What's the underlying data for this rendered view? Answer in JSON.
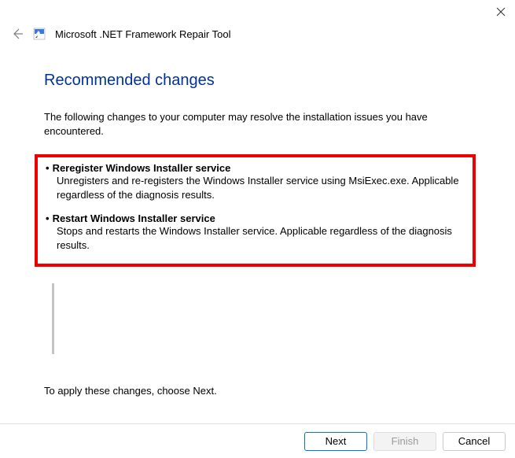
{
  "window": {
    "app_title": "Microsoft .NET Framework Repair Tool"
  },
  "page": {
    "heading": "Recommended changes",
    "intro": "The following changes to your computer may resolve the installation issues you have encountered.",
    "changes": [
      {
        "title": "Reregister Windows Installer service",
        "desc": "Unregisters and re-registers the Windows Installer service using MsiExec.exe. Applicable regardless of the diagnosis results."
      },
      {
        "title": "Restart Windows Installer service",
        "desc": "Stops and restarts the Windows Installer service. Applicable regardless of the diagnosis results."
      }
    ],
    "apply_text": "To apply these changes, choose Next."
  },
  "footer": {
    "next": "Next",
    "finish": "Finish",
    "cancel": "Cancel"
  }
}
